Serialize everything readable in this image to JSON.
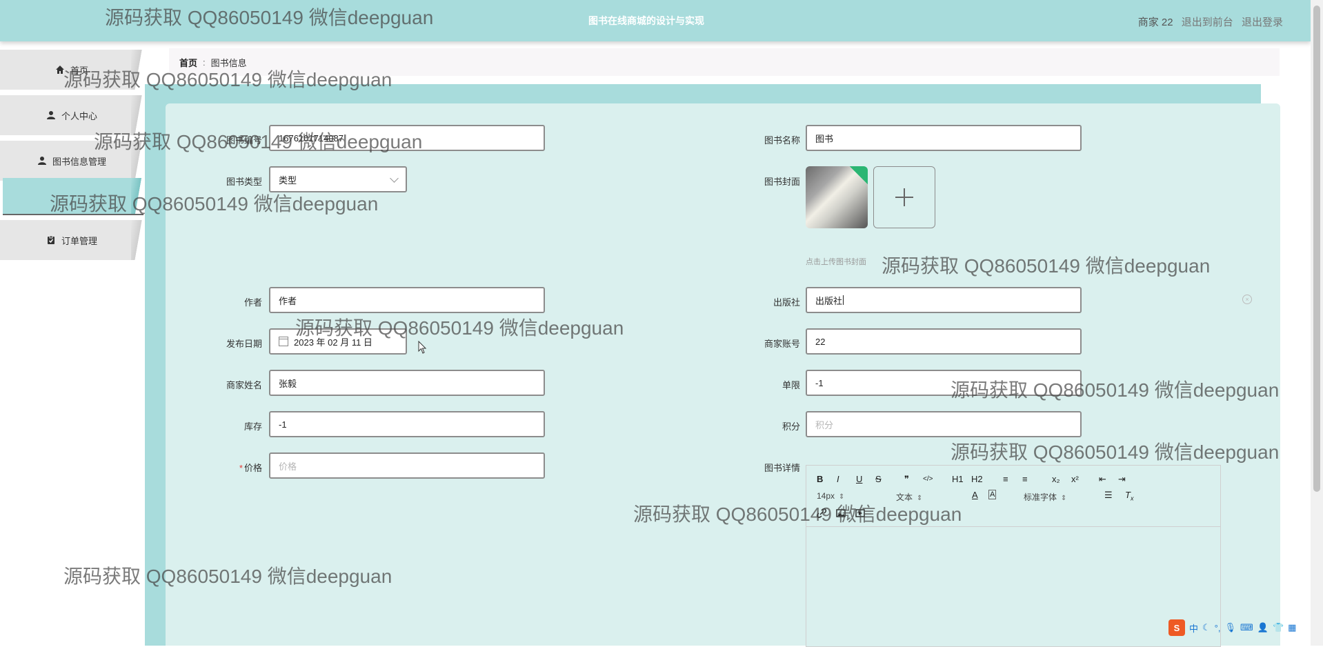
{
  "header": {
    "title": "图书在线商城的设计与实现",
    "user": "商家 22",
    "back_to_front": "退出到前台",
    "logout": "退出登录"
  },
  "sidebar": {
    "items": [
      {
        "label": "首页",
        "icon": "home-icon"
      },
      {
        "label": "个人中心",
        "icon": "user-icon"
      },
      {
        "label": "图书信息管理",
        "icon": "user-icon"
      },
      {
        "label": "",
        "icon": ""
      },
      {
        "label": "订单管理",
        "icon": "clipboard-icon"
      }
    ]
  },
  "breadcrumb": {
    "home": "首页",
    "separator": ":",
    "current": "图书信息"
  },
  "form": {
    "book_no": {
      "label": "图书编号",
      "value": "1676101714087"
    },
    "book_name": {
      "label": "图书名称",
      "value": "图书"
    },
    "book_type": {
      "label": "图书类型",
      "value": "类型"
    },
    "cover": {
      "label": "图书封面",
      "hint": "点击上传图书封面"
    },
    "author": {
      "label": "作者",
      "value": "作者"
    },
    "publisher": {
      "label": "出版社",
      "value": "出版社"
    },
    "publish_date": {
      "label": "发布日期",
      "value": "2023 年 02 月 11 日"
    },
    "merchant_account": {
      "label": "商家账号",
      "value": "22"
    },
    "merchant_name": {
      "label": "商家姓名",
      "value": "张毅"
    },
    "limit": {
      "label": "单限",
      "value": "-1"
    },
    "stock": {
      "label": "库存",
      "value": "-1"
    },
    "points": {
      "label": "积分",
      "placeholder": "积分"
    },
    "price": {
      "label": "价格",
      "placeholder": "价格",
      "required_mark": "*"
    },
    "details": {
      "label": "图书详情"
    }
  },
  "editor": {
    "font_size": "14px",
    "paragraph": "文本",
    "font_family": "标准字体",
    "buttons": [
      "B",
      "I",
      "U",
      "S",
      "❞",
      "</>",
      "H1",
      "H2",
      "≡",
      "≡",
      "x₂",
      "x²",
      "⇤",
      "⇥"
    ]
  },
  "watermark": "源码获取 QQ86050149 微信deepguan",
  "ime": {
    "lang": "中"
  },
  "colors": {
    "header_bg": "#a8dcdc",
    "panel_bg": "#daf0ee",
    "required": "#e53935"
  }
}
